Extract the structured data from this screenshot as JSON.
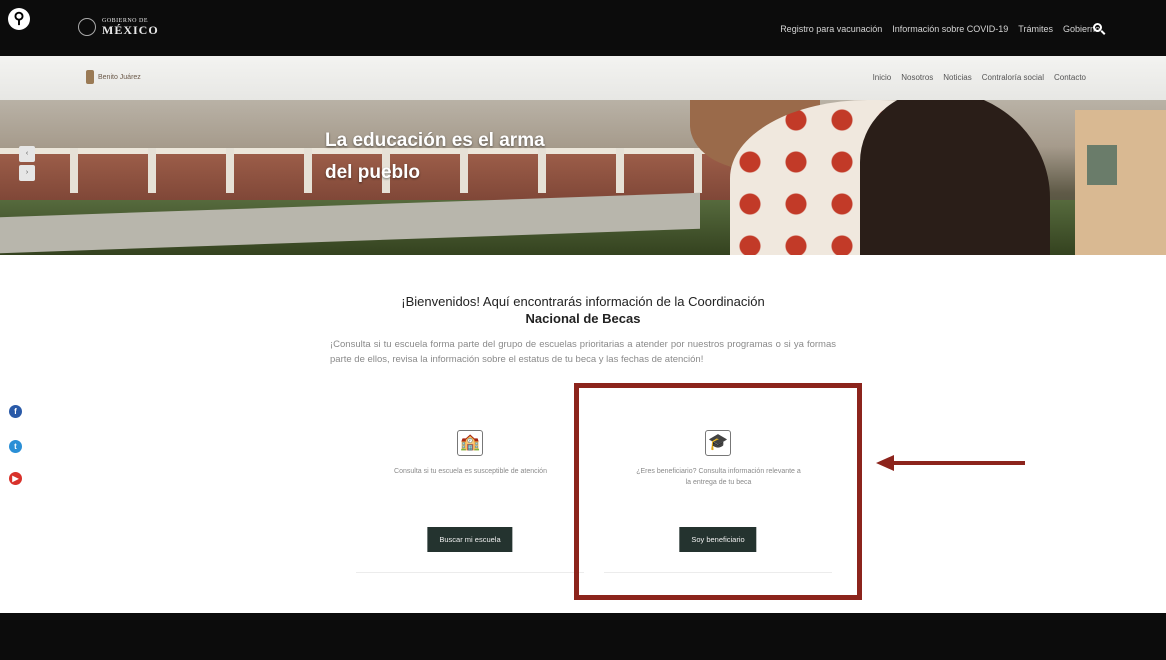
{
  "header": {
    "gov_line1": "GOBIERNO DE",
    "gov_line2": "MÉXICO",
    "nav": [
      "Registro para vacunación",
      "Información sobre COVID-19",
      "Trámites",
      "Gobierno"
    ]
  },
  "subheader": {
    "site_name": "Benito Juárez",
    "nav": [
      "Inicio",
      "Nosotros",
      "Noticias",
      "Contraloría social",
      "Contacto"
    ]
  },
  "hero": {
    "title_line1": "La educación es el arma",
    "title_line2": "del pueblo"
  },
  "main": {
    "welcome_line1": "¡Bienvenidos! Aquí encontrarás información de la Coordinación",
    "welcome_line2": "Nacional de Becas",
    "intro": "¡Consulta si tu escuela forma parte del grupo de escuelas prioritarias a atender por nuestros programas o si ya formas parte de ellos, revisa la información sobre el estatus de tu beca y las fechas de atención!",
    "cards": [
      {
        "text": "Consulta si tu escuela es susceptible de atención",
        "button": "Buscar mi escuela",
        "icon": "school-icon"
      },
      {
        "text": "¿Eres beneficiario? Consulta información relevante a la entrega de tu beca",
        "button": "Soy beneficiario",
        "icon": "student-icon"
      }
    ]
  },
  "colors": {
    "topbar": "#0c0c0c",
    "button": "#24332f",
    "highlight": "#8c241c",
    "facebook": "#2a5aa8",
    "twitter": "#2a8fd6",
    "youtube": "#d8312a"
  }
}
